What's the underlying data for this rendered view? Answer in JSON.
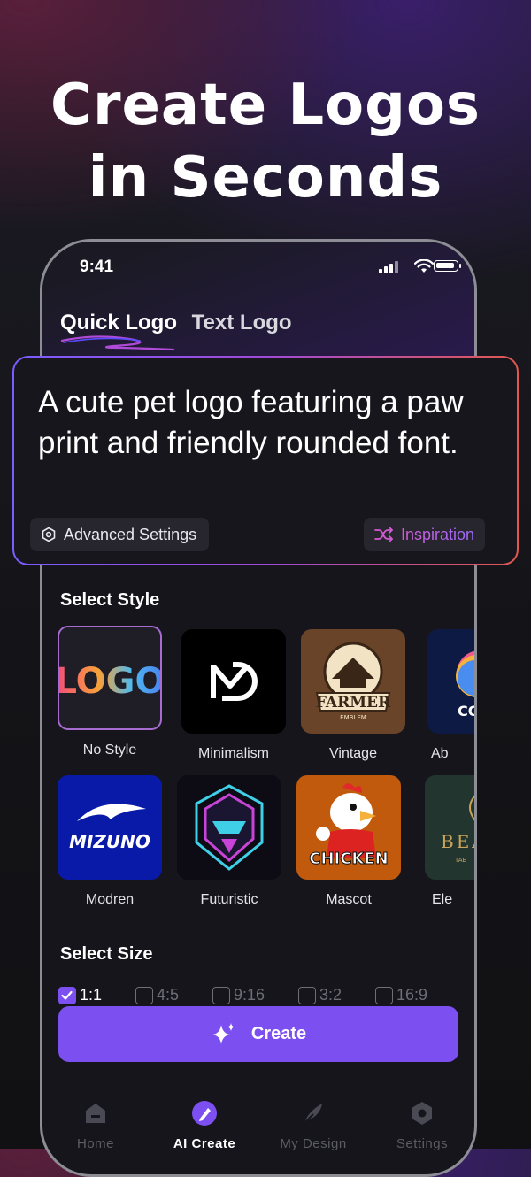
{
  "headline": {
    "line1": "Create Logos",
    "line2": "in Seconds"
  },
  "status_bar": {
    "time": "9:41"
  },
  "tabs": {
    "quick": "Quick Logo",
    "text": "Text Logo"
  },
  "prompt": {
    "text": "A cute pet logo featuring a paw print and friendly rounded font.",
    "advanced_label": "Advanced Settings",
    "inspiration_label": "Inspiration"
  },
  "style_section": {
    "title": "Select Style",
    "row1": [
      {
        "label": "No Style",
        "thumb_text": "LOGO"
      },
      {
        "label": "Minimalism"
      },
      {
        "label": "Vintage",
        "thumb_text": "FARMER",
        "thumb_sub": "EMBLEM"
      },
      {
        "label": "Ab",
        "thumb_text": "CO"
      }
    ],
    "row2": [
      {
        "label": "Modren",
        "thumb_text": "MIZUNO"
      },
      {
        "label": "Futuristic"
      },
      {
        "label": "Mascot",
        "thumb_text": "CHICKEN"
      },
      {
        "label": "Ele",
        "thumb_text": "BEA",
        "thumb_sub": "TAE"
      }
    ]
  },
  "size_section": {
    "title": "Select Size",
    "options": [
      "1:1",
      "4:5",
      "9:16",
      "3:2",
      "16:9"
    ],
    "selected": "1:1"
  },
  "create_button": {
    "label": "Create"
  },
  "bottom_nav": {
    "items": [
      "Home",
      "AI Create",
      "My Design",
      "Settings"
    ],
    "active": "AI Create"
  },
  "colors": {
    "accent": "#7c4ff0",
    "background": "#15151b",
    "card_border_start": "#7b5cff",
    "card_border_end": "#e2584f"
  }
}
